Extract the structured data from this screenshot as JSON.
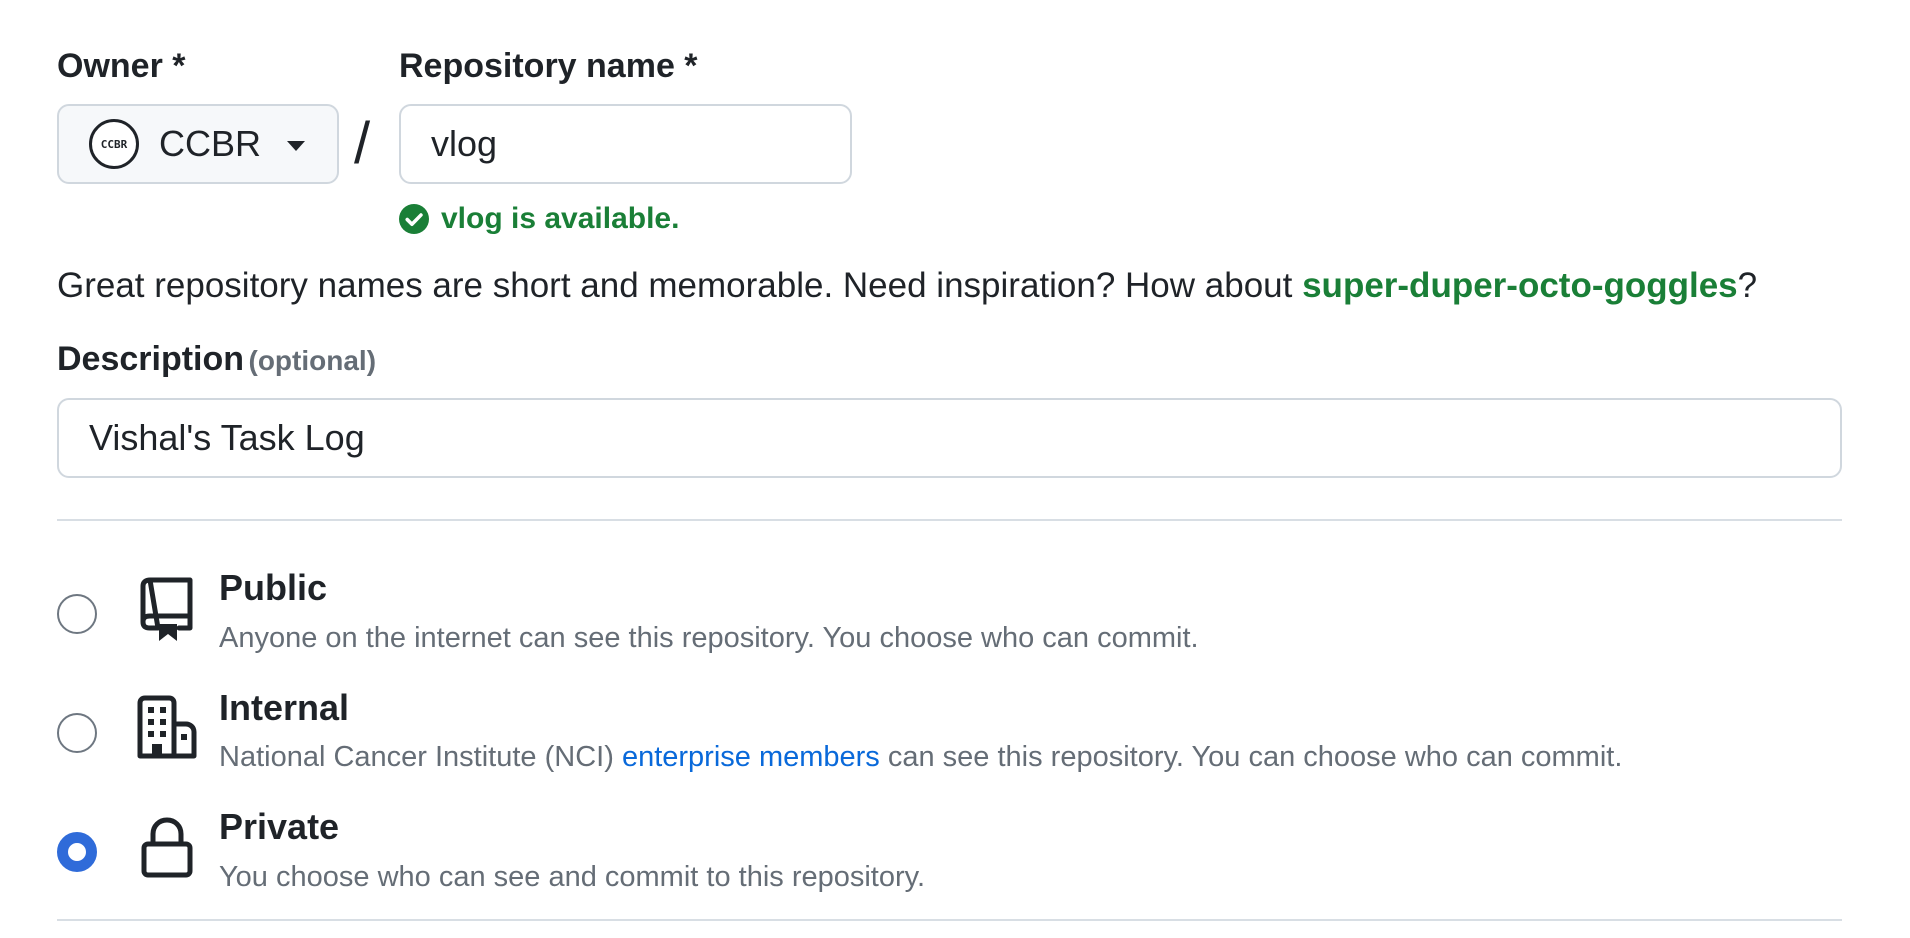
{
  "owner": {
    "label": "Owner *",
    "avatar_text": "CCBR",
    "selected": "CCBR",
    "icons": {
      "avatar": "org-avatar",
      "caret": "triangle-down-icon"
    }
  },
  "separator": "/",
  "repo_name": {
    "label": "Repository name *",
    "value": "vlog",
    "availability": "vlog is available.",
    "availability_icon": "check-circle-fill-icon"
  },
  "hint": {
    "prefix": "Great repository names are short and memorable. Need inspiration? How about ",
    "suggestion": "super-duper-octo-goggles",
    "suffix": "?"
  },
  "description": {
    "label": "Description",
    "optional": "(optional)",
    "value": "Vishal's Task Log"
  },
  "visibility": {
    "selected": "private",
    "options": [
      {
        "id": "public",
        "title": "Public",
        "icon": "repo-icon",
        "desc": "Anyone on the internet can see this repository. You choose who can commit."
      },
      {
        "id": "internal",
        "title": "Internal",
        "icon": "organization-icon",
        "desc_prefix": "National Cancer Institute (NCI) ",
        "desc_link": "enterprise members",
        "desc_suffix": " can see this repository. You can choose who can commit."
      },
      {
        "id": "private",
        "title": "Private",
        "icon": "lock-icon",
        "desc": "You choose who can see and commit to this repository."
      }
    ]
  },
  "colors": {
    "success_green": "#1a7f37",
    "link_blue": "#0969da",
    "radio_checked": "#2f6bd9",
    "text_primary": "#1f2328",
    "text_muted": "#656d76",
    "border": "#d0d7de"
  }
}
